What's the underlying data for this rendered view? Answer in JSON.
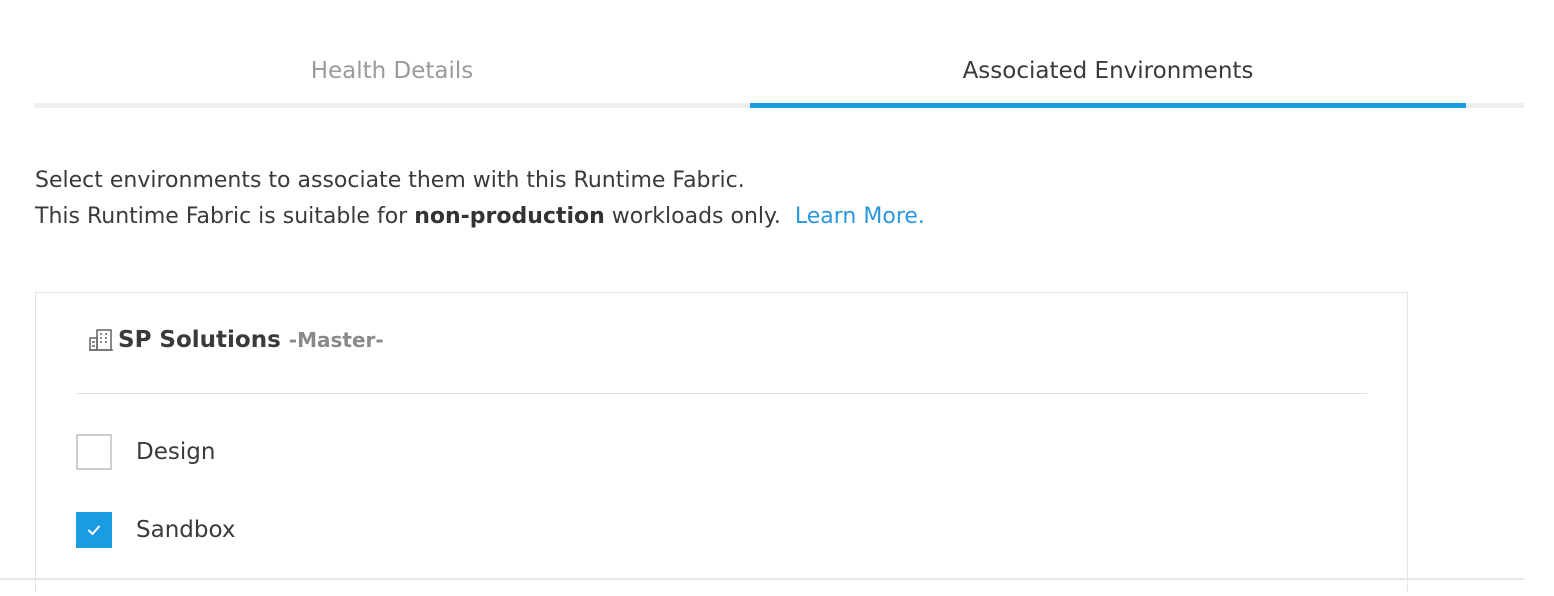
{
  "tabs": [
    {
      "label": "Health Details",
      "active": false
    },
    {
      "label": "Associated Environments",
      "active": true
    }
  ],
  "description": {
    "line1": "Select environments to associate them with this Runtime Fabric.",
    "line2_prefix": "This Runtime Fabric is suitable for ",
    "line2_bold": "non-production",
    "line2_suffix": " workloads only.",
    "learn_more": "Learn More."
  },
  "organization": {
    "icon": "building-icon",
    "name": "SP Solutions",
    "role": "-Master-",
    "environments": [
      {
        "label": "Design",
        "checked": false
      },
      {
        "label": "Sandbox",
        "checked": true
      }
    ]
  },
  "colors": {
    "accent": "#1b9be0",
    "link": "#2b97dd",
    "tab_inactive": "#9a9a9a",
    "text": "#3a3a3a"
  }
}
